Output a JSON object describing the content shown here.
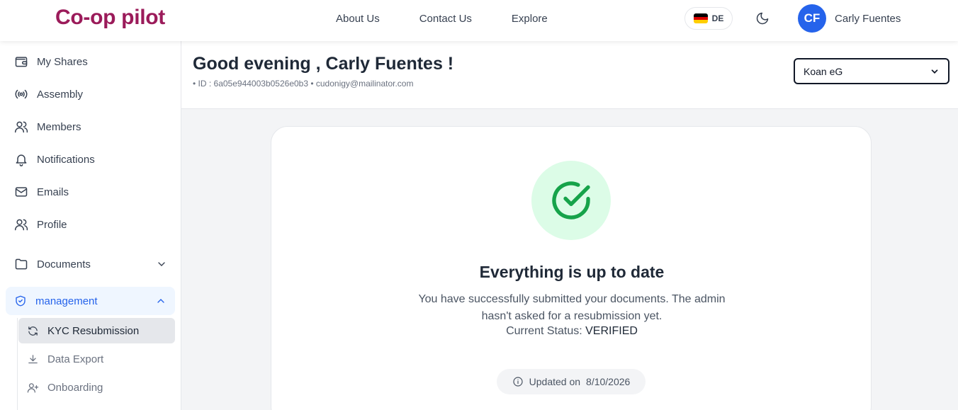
{
  "header": {
    "logo": "Co-op pilot",
    "nav": [
      "About Us",
      "Contact Us",
      "Explore"
    ],
    "language_code": "DE",
    "avatar_initials": "CF",
    "user_name": "Carly Fuentes"
  },
  "sidebar": {
    "items": [
      {
        "label": "My Shares",
        "icon": "wallet-icon"
      },
      {
        "label": "Assembly",
        "icon": "broadcast-icon"
      },
      {
        "label": "Members",
        "icon": "users-icon"
      },
      {
        "label": "Notifications",
        "icon": "bell-icon"
      },
      {
        "label": "Emails",
        "icon": "mail-icon"
      },
      {
        "label": "Profile",
        "icon": "users-icon"
      }
    ],
    "documents_label": "Documents",
    "management_label": "management",
    "management_items": [
      {
        "label": "KYC Resubmission",
        "icon": "refresh-icon",
        "active": true
      },
      {
        "label": "Data Export",
        "icon": "download-icon",
        "active": false
      },
      {
        "label": "Onboarding",
        "icon": "user-plus-icon",
        "active": false
      }
    ]
  },
  "greeting": {
    "title": "Good evening , Carly Fuentes !",
    "meta": "• ID : 6a05e944003b0526e0b3 • cudonigy@mailinator.com"
  },
  "coop_select": {
    "selected": "Koan eG"
  },
  "card": {
    "title": "Everything is up to date",
    "description": "You have successfully submitted your documents. The admin hasn't asked for a resubmission yet.",
    "status_label": "Current Status:",
    "status_value": "VERIFIED",
    "updated_label": "Updated on",
    "updated_date": "8/10/2026"
  },
  "colors": {
    "brand": "#9b1b5a",
    "accent": "#2563eb",
    "success": "#16a34a",
    "success_bg": "#dcfce7"
  }
}
